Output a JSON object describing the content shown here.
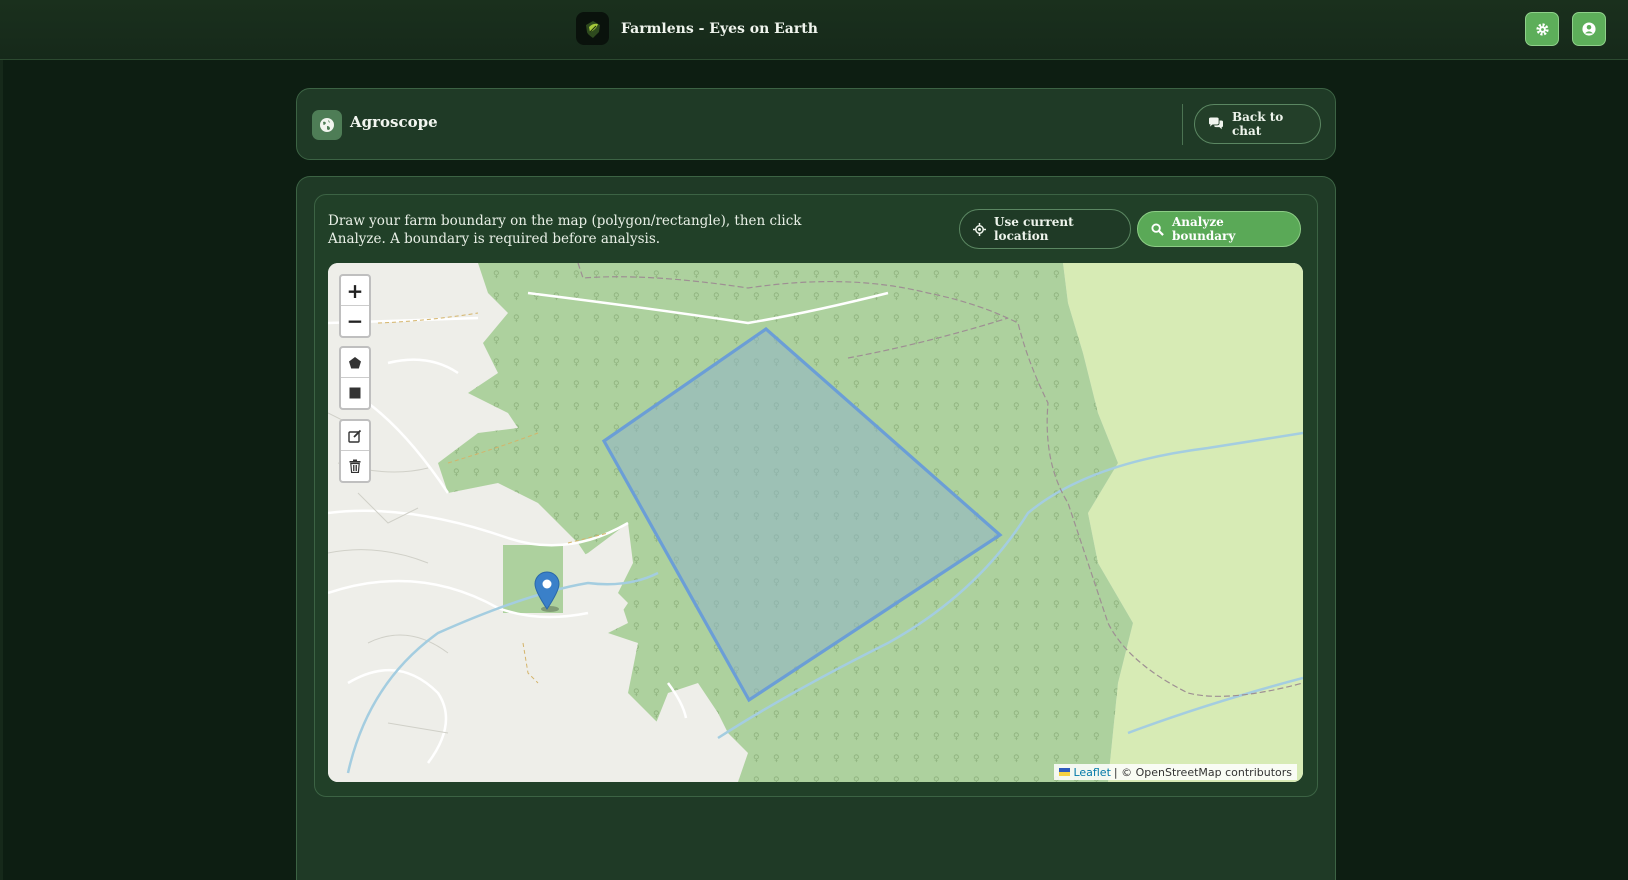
{
  "app": {
    "title": "Farmlens - Eyes on Earth"
  },
  "header": {
    "title": "Agroscope",
    "back_label": "Back to chat"
  },
  "panel": {
    "instructions": "Draw your farm boundary on the map (polygon/rectangle), then click Analyze. A boundary is required before analysis.",
    "use_location_label": "Use current location",
    "analyze_label": "Analyze boundary"
  },
  "map": {
    "zoom_in": "+",
    "zoom_out": "−",
    "attribution_leaflet": "Leaflet",
    "attribution_rest": "| © OpenStreetMap contributors",
    "tools": [
      "draw-polygon-icon",
      "draw-rectangle-icon",
      "edit-layers-icon",
      "delete-layers-icon"
    ]
  },
  "colors": {
    "accent": "#5aa957",
    "panel": "#1f3a26",
    "background": "#0d1e12",
    "boundary_stroke": "#6b9ed6"
  }
}
